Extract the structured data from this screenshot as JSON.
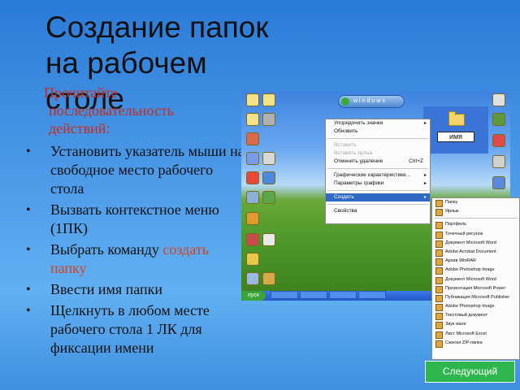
{
  "slide": {
    "title_line1": "Создание папок",
    "title_line2": "на рабочем столе",
    "lead": [
      "Прочитайте",
      "последовательность",
      "действий:"
    ],
    "steps": [
      {
        "text": "Установить указатель мыши на свободное место рабочего стола"
      },
      {
        "text": "Вызвать контекстное меню (1ПК)"
      },
      {
        "pre": "Выбрать команду ",
        "accent": "создать папку"
      },
      {
        "text": "Ввести имя папки"
      },
      {
        "text": "Щелкнуть в любом месте рабочего стола 1 ЛК для фиксации имени"
      }
    ],
    "next_button": "Следующий",
    "colors": {
      "title": "#101010",
      "lead": "#cc2a1a",
      "accent": "#d8401c",
      "next_bg": "#2eb64e"
    }
  },
  "screenshot": {
    "logo_text": "windows",
    "start_label": "пуск",
    "folder_name": "имя",
    "context_menu": [
      {
        "label": "Упорядочить значки",
        "arrow": "▸"
      },
      {
        "label": "Обновить"
      },
      {
        "sep": true
      },
      {
        "label": "Вставить",
        "dim": true
      },
      {
        "label": "Вставить ярлык",
        "dim": true
      },
      {
        "label": "Отменить удаление",
        "shortcut": "Ctrl+Z"
      },
      {
        "sep": true
      },
      {
        "label": "Графические характеристики...",
        "arrow": "▸"
      },
      {
        "label": "Параметры графики",
        "arrow": "▸"
      },
      {
        "sep": true
      },
      {
        "label": "Создать",
        "arrow": "▸",
        "selected": true
      },
      {
        "sep": true
      },
      {
        "label": "Свойства"
      }
    ],
    "submenu": [
      {
        "label": "Папку"
      },
      {
        "label": "Ярлык"
      },
      {
        "sep": true
      },
      {
        "label": "Портфель"
      },
      {
        "label": "Точечный рисунок"
      },
      {
        "label": "Документ Microsoft Word"
      },
      {
        "label": "Adobe Acrobat Document"
      },
      {
        "label": "Архив WinRAR"
      },
      {
        "label": "Adobe Photoshop Image"
      },
      {
        "label": "Документ Microsoft Word"
      },
      {
        "label": "Презентация Microsoft Power"
      },
      {
        "label": "Публикация Microsoft Publisher"
      },
      {
        "label": "Adobe Photoshop Image"
      },
      {
        "label": "Текстовый документ"
      },
      {
        "label": "Звук wave"
      },
      {
        "label": "Лист Microsoft Excel"
      },
      {
        "label": "Сжатая ZIP-папка"
      }
    ]
  }
}
